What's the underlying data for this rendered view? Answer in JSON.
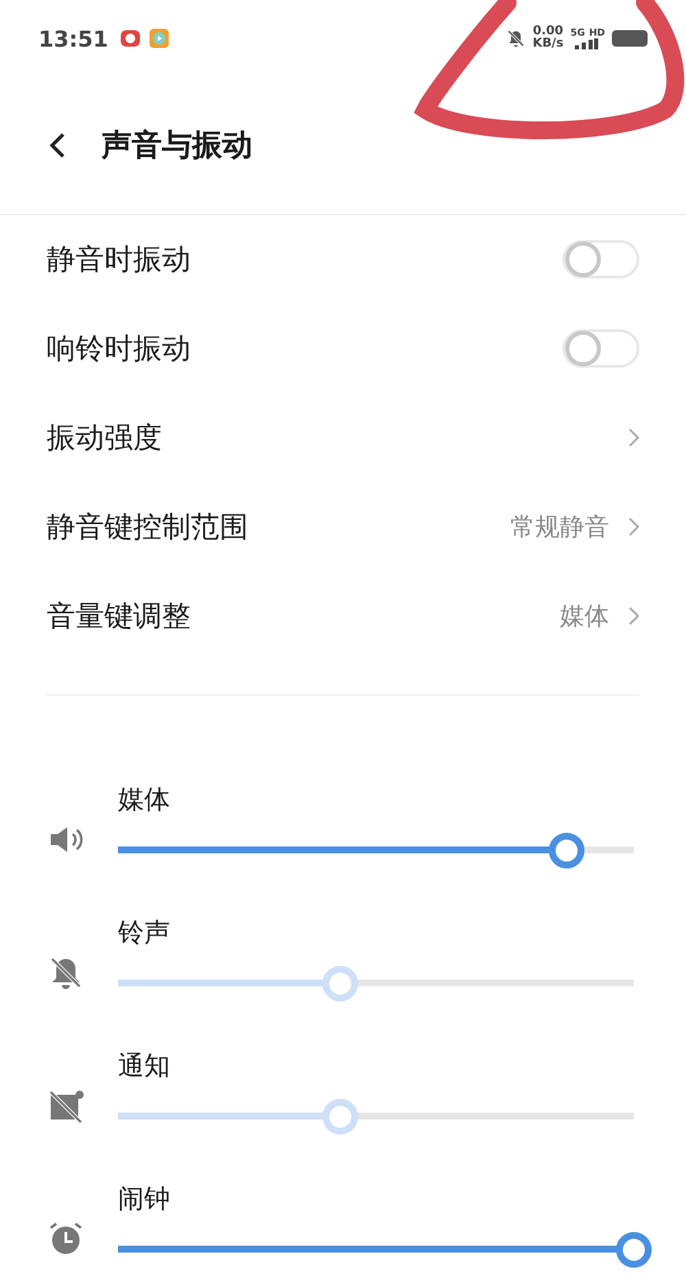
{
  "status_bar": {
    "time": "13:51",
    "speed_value": "0.00",
    "speed_unit": "KB/s",
    "network": "5G",
    "hd": "HD"
  },
  "header": {
    "title": "声音与振动"
  },
  "settings": [
    {
      "kind": "toggle",
      "label": "静音时振动",
      "on": false
    },
    {
      "kind": "toggle",
      "label": "响铃时振动",
      "on": false
    },
    {
      "kind": "link",
      "label": "振动强度"
    },
    {
      "kind": "link",
      "label": "静音键控制范围",
      "value": "常规静音"
    },
    {
      "kind": "link",
      "label": "音量键调整",
      "value": "媒体"
    }
  ],
  "volumes": [
    {
      "kind": "media",
      "label": "媒体",
      "level": 0.87,
      "disabled": false
    },
    {
      "kind": "ringtone",
      "label": "铃声",
      "level": 0.43,
      "disabled": true
    },
    {
      "kind": "notification",
      "label": "通知",
      "level": 0.43,
      "disabled": true
    },
    {
      "kind": "alarm",
      "label": "闹钟",
      "level": 1,
      "disabled": false
    }
  ]
}
